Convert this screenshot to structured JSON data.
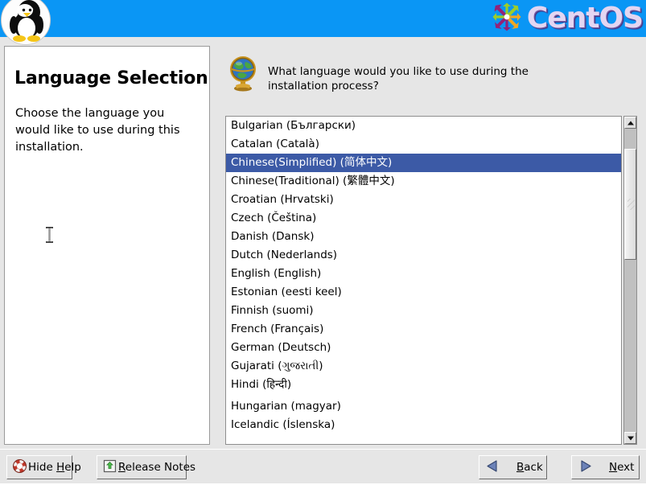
{
  "header": {
    "brand_name": "CentOS",
    "penguin_icon": "tux-penguin-icon",
    "pinwheel_icon": "centos-pinwheel-icon",
    "background_color": "#0a96f5",
    "wordmark_color": "#e3d6f2"
  },
  "help_panel": {
    "title": "Language Selection",
    "body": "Choose the language you would like to use during this installation.",
    "cursor_icon": "text-ibeam-cursor"
  },
  "main": {
    "globe_icon": "globe-icon",
    "question": "What language would you like to use during the installation process?",
    "selection_color": "#3c5aa6",
    "languages": [
      {
        "label": "Bulgarian (Български)",
        "selected": false,
        "gap_before": false
      },
      {
        "label": "Catalan (Català)",
        "selected": false,
        "gap_before": false
      },
      {
        "label": "Chinese(Simplified) (简体中文)",
        "selected": true,
        "gap_before": false
      },
      {
        "label": "Chinese(Traditional) (繁體中文)",
        "selected": false,
        "gap_before": false
      },
      {
        "label": "Croatian (Hrvatski)",
        "selected": false,
        "gap_before": false
      },
      {
        "label": "Czech (Čeština)",
        "selected": false,
        "gap_before": false
      },
      {
        "label": "Danish (Dansk)",
        "selected": false,
        "gap_before": false
      },
      {
        "label": "Dutch (Nederlands)",
        "selected": false,
        "gap_before": false
      },
      {
        "label": "English (English)",
        "selected": false,
        "gap_before": false
      },
      {
        "label": "Estonian (eesti keel)",
        "selected": false,
        "gap_before": false
      },
      {
        "label": "Finnish (suomi)",
        "selected": false,
        "gap_before": false
      },
      {
        "label": "French (Français)",
        "selected": false,
        "gap_before": false
      },
      {
        "label": "German (Deutsch)",
        "selected": false,
        "gap_before": false
      },
      {
        "label": "Gujarati (ગુજરાતી)",
        "selected": false,
        "gap_before": false
      },
      {
        "label": "Hindi (हिन्दी)",
        "selected": false,
        "gap_before": false
      },
      {
        "label": "Hungarian (magyar)",
        "selected": false,
        "gap_before": true
      },
      {
        "label": "Icelandic (Íslenska)",
        "selected": false,
        "gap_before": false
      }
    ]
  },
  "scrollbar": {
    "up_icon": "scroll-up-arrow-icon",
    "down_icon": "scroll-down-arrow-icon",
    "thumb_icon": "scrollbar-thumb"
  },
  "buttons": {
    "hide_help": {
      "label_pre": "Hide ",
      "label_key": "H",
      "label_post": "elp",
      "icon": "lifebuoy-help-icon"
    },
    "release_notes": {
      "label_key": "R",
      "label_post": "elease Notes",
      "icon": "release-notes-icon"
    },
    "back": {
      "label_key": "B",
      "label_post": "ack",
      "icon": "arrow-left-icon"
    },
    "next": {
      "label_key": "N",
      "label_post": "ext",
      "icon": "arrow-right-icon"
    }
  }
}
